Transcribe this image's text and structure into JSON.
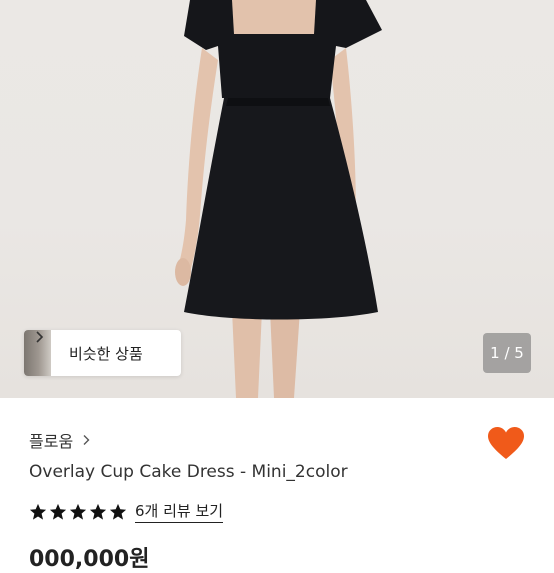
{
  "product_image": {
    "counter": "1 / 5",
    "similar_button_label": "비슷한 상품"
  },
  "product": {
    "brand": "플로움",
    "name": "Overlay Cup Cake Dress - Mini_2color",
    "rating_stars": 5,
    "review_link": "6개 리뷰 보기",
    "price_partial": "000,000원"
  },
  "colors": {
    "accent": "#f05a1a",
    "star": "#111111"
  },
  "icons": [
    "chevron-right-icon",
    "heart-icon",
    "star-icon"
  ]
}
